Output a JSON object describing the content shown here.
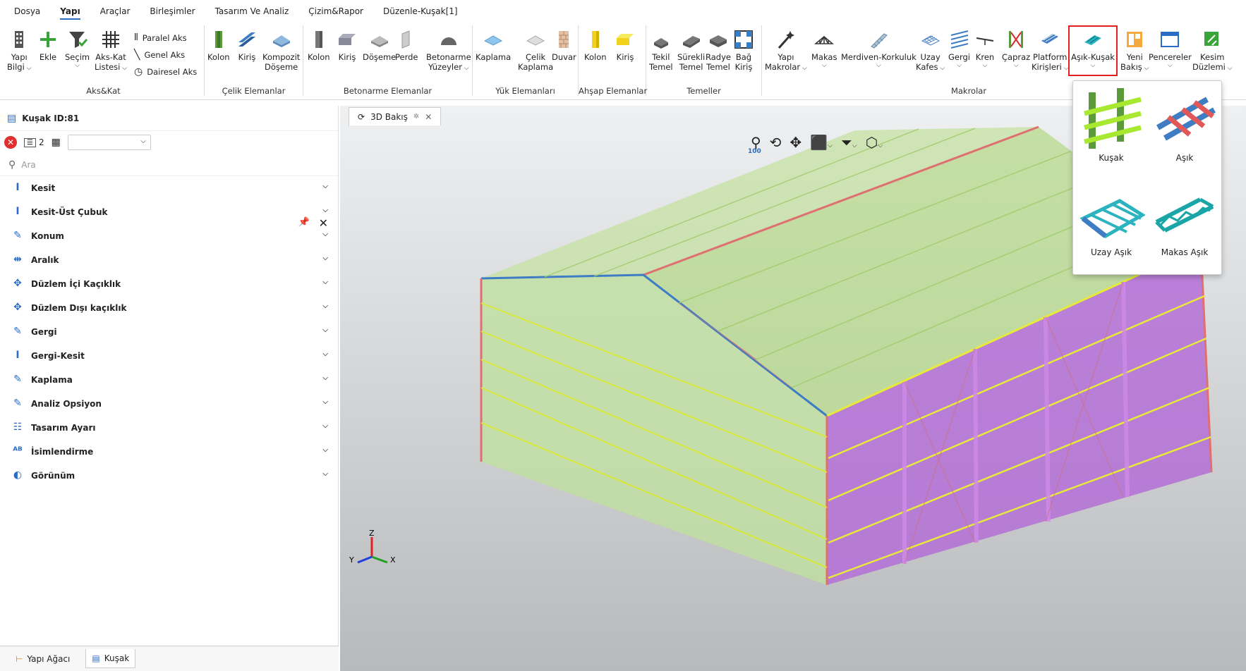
{
  "menu": [
    "Dosya",
    "Yapı",
    "Araçlar",
    "Birleşimler",
    "Tasarım Ve Analiz",
    "Çizim&Rapor",
    "Düzenle-Kuşak[1]"
  ],
  "ribbon": {
    "groups": {
      "aks_kat": "Aks&Kat",
      "celik": "Çelik Elemanlar",
      "betonarme": "Betonarme Elemanlar",
      "yuk": "Yük Elemanları",
      "ahsap": "Ahşap Elemanlar",
      "temeller": "Temeller",
      "makrolar": "Makrolar"
    },
    "buttons": {
      "yapi_bilgi": [
        "Yapı",
        "Bilgi"
      ],
      "ekle": "Ekle",
      "secim": "Seçim",
      "aks_kat_listesi": [
        "Aks-Kat",
        "Listesi"
      ],
      "paralel_aks": "Paralel Aks",
      "genel_aks": "Genel Aks",
      "dairesel_aks": "Dairesel Aks",
      "celik_kolon": "Kolon",
      "celik_kiris": "Kiriş",
      "kompozit_doseme": [
        "Kompozit",
        "Döşeme"
      ],
      "bet_kolon": "Kolon",
      "bet_kiris": "Kiriş",
      "doseme": "Döşeme",
      "perde": "Perde",
      "betonarme_yuzeyler": [
        "Betonarme",
        "Yüzeyler"
      ],
      "kaplama": "Kaplama",
      "celik_kaplama": [
        "Çelik",
        "Kaplama"
      ],
      "duvar": "Duvar",
      "ahsap_kolon": "Kolon",
      "ahsap_kiris": "Kiriş",
      "tekil_temel": [
        "Tekil",
        "Temel"
      ],
      "surekli_temel": [
        "Sürekli",
        "Temel"
      ],
      "radye_temel": [
        "Radye",
        "Temel"
      ],
      "bag_kiris": [
        "Bağ",
        "Kiriş"
      ],
      "yapi_makrolar": [
        "Yapı",
        "Makrolar"
      ],
      "makas": "Makas",
      "merdiven_korkuluk": "Merdiven-Korkuluk",
      "uzay_kafes": [
        "Uzay",
        "Kafes"
      ],
      "gergi": "Gergi",
      "kren": "Kren",
      "capraz": "Çapraz",
      "platform_kirisleri": [
        "Platform",
        "Kirişleri"
      ],
      "asik_kusak": "Aşık-Kuşak",
      "yeni_bakis": [
        "Yeni",
        "Bakış"
      ],
      "pencereler": "Pencereler",
      "kesim_duzlemi": [
        "Kesim",
        "Düzlemi"
      ]
    }
  },
  "popup": {
    "items": [
      "Kuşak",
      "Aşık",
      "Uzay Aşık",
      "Makas Aşık"
    ]
  },
  "panel": {
    "title": "Kuşak ID:81",
    "count": "2",
    "search_placeholder": "Ara",
    "rows": [
      "Kesit",
      "Kesit-Üst Çubuk",
      "Konum",
      "Aralık",
      "Düzlem İçi Kaçıklık",
      "Düzlem Dışı kaçıklık",
      "Gergi",
      "Gergi-Kesit",
      "Kaplama",
      "Analiz Opsiyon",
      "Tasarım Ayarı",
      "İsimlendirme",
      "Görünüm"
    ],
    "bottom_tabs": [
      "Yapı Ağacı",
      "Kuşak"
    ]
  },
  "viewport": {
    "tab": "3D Bakış",
    "zoom": "100",
    "axes": {
      "x": "X",
      "y": "Y",
      "z": "Z"
    }
  },
  "colors": {
    "highlight": "#e02020",
    "roof": "#b7d98b",
    "wall_purple": "#b46fd6",
    "purlin": "#e8ea3a",
    "frame": "#e07070"
  }
}
